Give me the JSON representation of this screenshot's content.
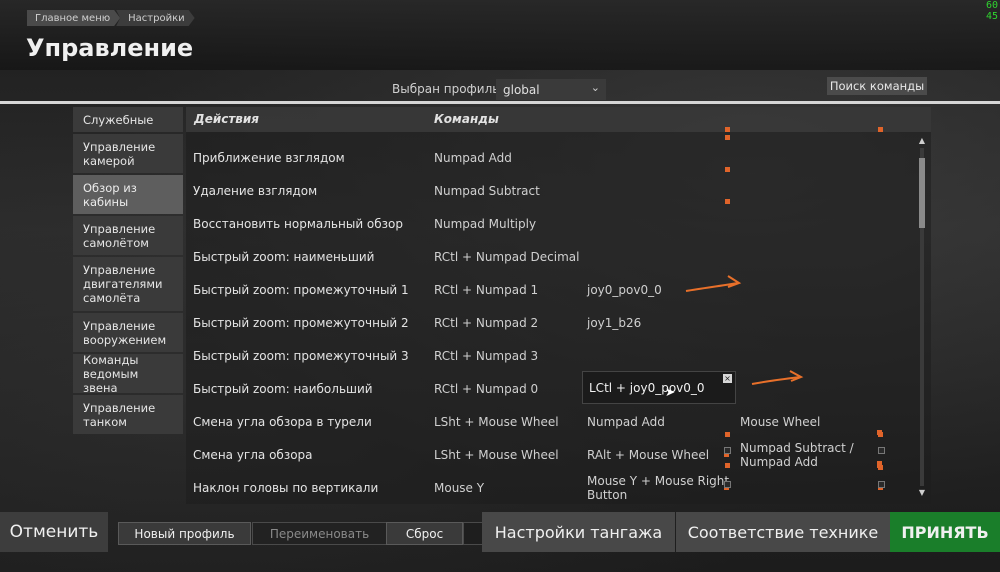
{
  "fps": {
    "line1": "60",
    "line2": "45"
  },
  "breadcrumb": {
    "item1": "Главное меню",
    "item2": "Настройки"
  },
  "page_title": "Управление",
  "profile": {
    "label": "Выбран профиль",
    "value": "global"
  },
  "search_button": "Поиск команды",
  "sidebar": {
    "items": [
      {
        "label": "Служебные"
      },
      {
        "label": "Управление камерой"
      },
      {
        "label": "Обзор из кабины"
      },
      {
        "label": "Управление самолётом"
      },
      {
        "label": "Управление двигателями самолёта"
      },
      {
        "label": "Управление вооружением"
      },
      {
        "label": "Команды ведомым звена"
      },
      {
        "label": "Управление танком"
      }
    ],
    "active_index": 2
  },
  "table": {
    "headers": {
      "actions": "Действия",
      "commands": "Команды"
    },
    "rows": [
      {
        "action": "Приближение взглядом",
        "cmd": "Numpad Add",
        "b2": "",
        "b3": ""
      },
      {
        "action": "Удаление взглядом",
        "cmd": "Numpad Subtract",
        "b2": "",
        "b3": ""
      },
      {
        "action": "Восстановить нормальный обзор",
        "cmd": "Numpad Multiply",
        "b2": "",
        "b3": ""
      },
      {
        "action": "Быстрый zoom: наименьший",
        "cmd": "RCtl + Numpad Decimal",
        "b2": "",
        "b3": ""
      },
      {
        "action": "Быстрый zoom: промежуточный 1",
        "cmd": "RCtl + Numpad 1",
        "b2": "joy0_pov0_0",
        "b3": ""
      },
      {
        "action": "Быстрый zoom: промежуточный 2",
        "cmd": "RCtl + Numpad 2",
        "b2": "joy1_b26",
        "b3": ""
      },
      {
        "action": "Быстрый zoom: промежуточный 3",
        "cmd": "RCtl + Numpad 3",
        "b2": "",
        "b3": ""
      },
      {
        "action": "Быстрый zoom: наибольший",
        "cmd": "RCtl + Numpad 0",
        "b2": "",
        "b3": ""
      },
      {
        "action": "Смена угла обзора в турели",
        "cmd": "LSht + Mouse Wheel",
        "b2": "Numpad Add",
        "b3": "Mouse Wheel"
      },
      {
        "action": "Смена угла обзора",
        "cmd": "LSht + Mouse Wheel",
        "b2": "RAlt + Mouse Wheel",
        "b3": "Numpad Subtract / Numpad Add"
      },
      {
        "action": "Наклон головы по вертикали",
        "cmd": "Mouse Y",
        "b2": "Mouse Y + Mouse Right Button",
        "b3": ""
      }
    ]
  },
  "popup": {
    "value": "LCtl + joy0_pov0_0",
    "close": "×"
  },
  "annotation_color": "#e8702a",
  "accent_green": "#1a7e2a",
  "bottom": {
    "cancel": "Отменить",
    "new_profile": "Новый профиль",
    "rename": "Переименовать",
    "reset": "Сброс",
    "pitch_settings": "Настройки тангажа",
    "vehicle_match": "Соответствие технике",
    "accept": "ПРИНЯТЬ"
  }
}
